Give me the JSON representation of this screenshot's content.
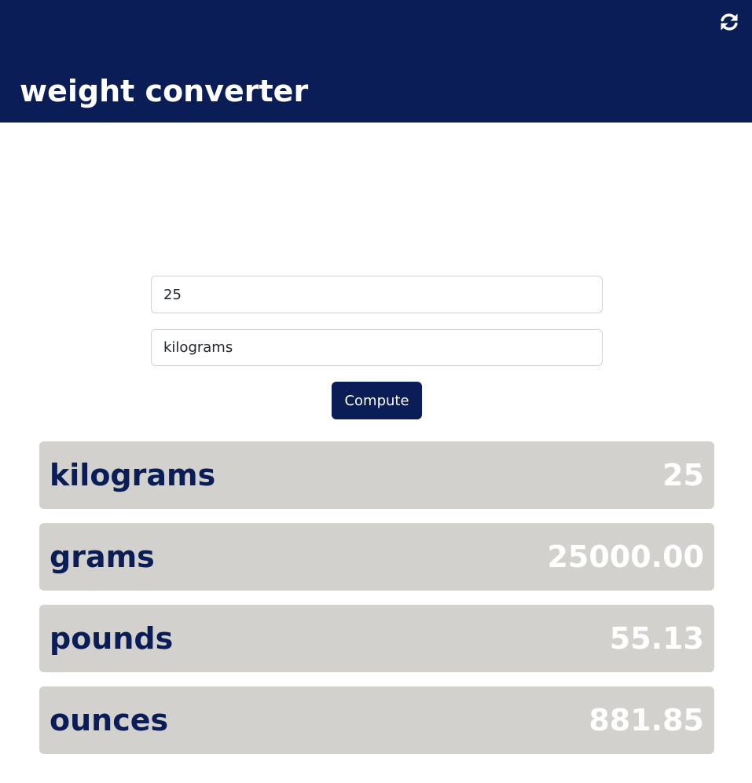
{
  "header": {
    "title": "weight converter",
    "refresh_icon": "refresh-icon",
    "background_color": "#0b1d57"
  },
  "form": {
    "value_input": {
      "value": "25"
    },
    "unit_select": {
      "value": "kilograms"
    },
    "compute_label": "Compute"
  },
  "results": [
    {
      "unit": "kilograms",
      "value": "25"
    },
    {
      "unit": "grams",
      "value": "25000.00"
    },
    {
      "unit": "pounds",
      "value": "55.13"
    },
    {
      "unit": "ounces",
      "value": "881.85"
    }
  ],
  "colors": {
    "accent": "#0b1d57",
    "result_background": "#d2d1cd",
    "result_value": "#ffffff"
  }
}
